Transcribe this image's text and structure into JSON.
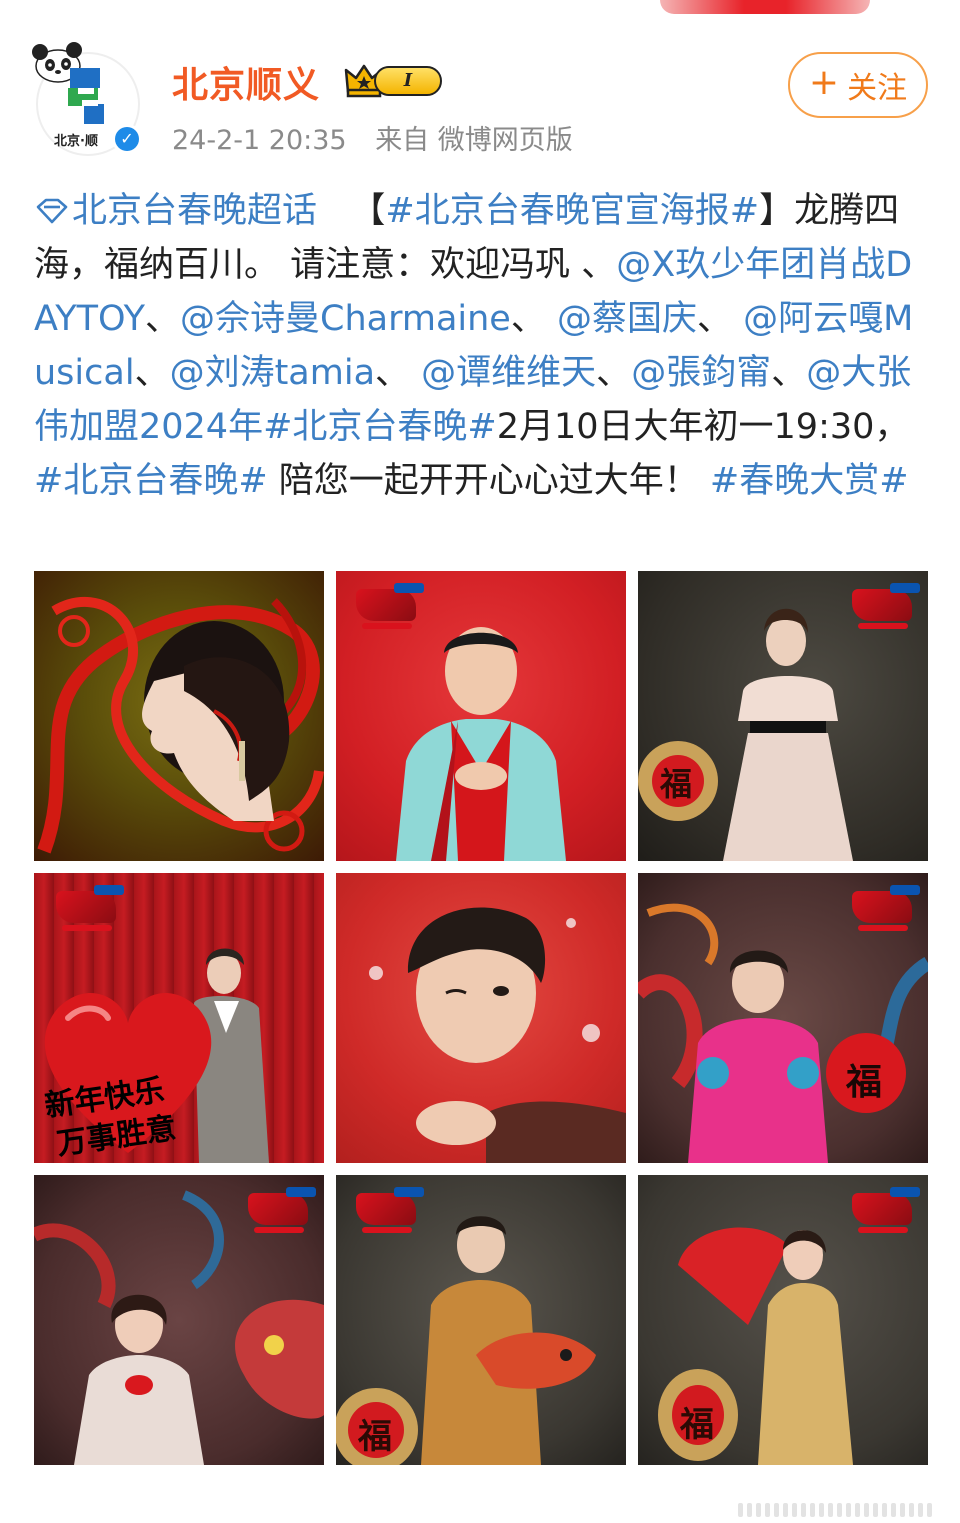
{
  "user": {
    "name": "北京顺义",
    "level": "I",
    "avatar_logo_text": "北京·顺",
    "verified_symbol": "✓"
  },
  "meta": {
    "time": "24-2-1 20:35",
    "source": "来自 微博网页版"
  },
  "follow_button": {
    "plus": "+",
    "label": "关注"
  },
  "post": {
    "topic": "北京台春晚超话",
    "segments": [
      {
        "text": "【",
        "link": false
      },
      {
        "text": "#北京台春晚官宣海报#",
        "link": true
      },
      {
        "text": "】龙腾四海，福纳百川。 请注意：欢迎冯巩 、",
        "link": false
      },
      {
        "text": "@X玖少年团肖战DAYTOY",
        "link": true
      },
      {
        "text": "、",
        "link": false
      },
      {
        "text": "@佘诗曼Charmaine",
        "link": true
      },
      {
        "text": "、 ",
        "link": false
      },
      {
        "text": "@蔡国庆",
        "link": true
      },
      {
        "text": "、 ",
        "link": false
      },
      {
        "text": "@阿云嘎Musical",
        "link": true
      },
      {
        "text": "、",
        "link": false
      },
      {
        "text": "@刘涛tamia",
        "link": true
      },
      {
        "text": "、 ",
        "link": false
      },
      {
        "text": "@谭维维天",
        "link": true
      },
      {
        "text": "、",
        "link": false
      },
      {
        "text": "@張鈞甯",
        "link": true
      },
      {
        "text": "、",
        "link": false
      },
      {
        "text": "@大张伟加盟2024年",
        "link": true
      },
      {
        "text": "#北京台春晚#",
        "link": true
      },
      {
        "text": "2月10日大年初一19:30，",
        "link": false
      },
      {
        "text": "#北京台春晚#",
        "link": true
      },
      {
        "text": " 陪您一起开开心心过大年！ ",
        "link": false
      },
      {
        "text": "#春晚大赏#",
        "link": true
      }
    ]
  },
  "images": {
    "poster_5_text_line1": "新年快乐",
    "poster_5_text_line2": "万事胜意",
    "fu_char": "福",
    "colors": {
      "brand_orange": "#f15a24",
      "link_blue": "#3d7fc4",
      "festival_red": "#d9121d"
    }
  }
}
